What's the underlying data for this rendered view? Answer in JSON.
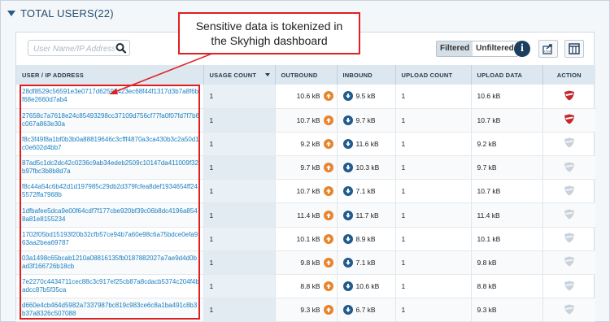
{
  "section": {
    "title": "TOTAL USERS(22)"
  },
  "search": {
    "placeholder": "User Name/IP Address"
  },
  "toggle": {
    "filtered": "Filtered",
    "unfiltered": "Unfiltered"
  },
  "toolbar": {
    "info_label": "i"
  },
  "table": {
    "headers": {
      "user": "USER / IP ADDRESS",
      "usage": "USAGE COUNT",
      "outbound": "OUTBOUND",
      "inbound": "INBOUND",
      "upload_count": "UPLOAD COUNT",
      "upload_data": "UPLOAD DATA",
      "action": "ACTION"
    },
    "rows": [
      {
        "user": "28df8529c56591e3e0717d62597423ec68f44f1317d3b7a8f6bf68e2660d7ab4",
        "usage": "1",
        "outbound": "10.6 kB",
        "inbound": "9.5 kB",
        "upload_count": "1",
        "upload_data": "10.6 kB",
        "shield": "red"
      },
      {
        "user": "27658c7a7618e24c85493298cc37109d756cf77fa0f07fd7f7b6c067a863e30a",
        "usage": "1",
        "outbound": "10.7 kB",
        "inbound": "9.7 kB",
        "upload_count": "1",
        "upload_data": "10.7 kB",
        "shield": "red"
      },
      {
        "user": "f8c3f49f8a1bf0b3b0a88819646c3cfff4870a3ca430b3c2a50d1c0e602d4bb7",
        "usage": "1",
        "outbound": "9.2 kB",
        "inbound": "11.6 kB",
        "upload_count": "1",
        "upload_data": "9.2 kB",
        "shield": "gray"
      },
      {
        "user": "87ad5c1dc2dc42c0236c9ab34edeb2509c10147da411009f32b97fbc3b8b8d7a",
        "usage": "1",
        "outbound": "9.7 kB",
        "inbound": "10.3 kB",
        "upload_count": "1",
        "upload_data": "9.7 kB",
        "shield": "gray"
      },
      {
        "user": "f8c44a54c6b42d1d197985c29db2d379fcfea8def1934654ff245572ffa7968b",
        "usage": "1",
        "outbound": "10.7 kB",
        "inbound": "7.1 kB",
        "upload_count": "1",
        "upload_data": "10.7 kB",
        "shield": "gray"
      },
      {
        "user": "1dfbafee5dca9e00f64cdf7f177cbe920bf39c06b8dc4196a8548a81e8155234",
        "usage": "1",
        "outbound": "11.4 kB",
        "inbound": "11.7 kB",
        "upload_count": "1",
        "upload_data": "11.4 kB",
        "shield": "gray"
      },
      {
        "user": "1702f05bd15193f20b32cfb57ce94b7a60e98c6a75bdce0efa963aa2bea69787",
        "usage": "1",
        "outbound": "10.1 kB",
        "inbound": "8.9 kB",
        "upload_count": "1",
        "upload_data": "10.1 kB",
        "shield": "gray"
      },
      {
        "user": "03a1498c65bcab1210a08816135fb0187882027a7ae9d4d0bad3f166726b18cb",
        "usage": "1",
        "outbound": "9.8 kB",
        "inbound": "7.1 kB",
        "upload_count": "1",
        "upload_data": "9.8 kB",
        "shield": "gray"
      },
      {
        "user": "7e2270c4434711cec88c3c917ef25cb87a8cdacb5374c204f4badcc87b5f35ca",
        "usage": "1",
        "outbound": "8.8 kB",
        "inbound": "10.6 kB",
        "upload_count": "1",
        "upload_data": "8.8 kB",
        "shield": "gray"
      },
      {
        "user": "d660e4cb464d5982a7337987bc819c983ce6c8a1ba491c8b3b37a8326c507088",
        "usage": "1",
        "outbound": "9.3 kB",
        "inbound": "6.7 kB",
        "upload_count": "1",
        "upload_data": "9.3 kB",
        "shield": "gray"
      }
    ]
  },
  "callout": {
    "line1": "Sensitive data is tokenized in",
    "line2": "the Skyhigh dashboard"
  },
  "colors": {
    "highlight": "#e02020",
    "link": "#1a7fc1",
    "shield_red": "#c8252c",
    "shield_gray": "#c9d2da",
    "upload_arrow": "#e8842c",
    "download_arrow": "#1f5b8c"
  },
  "icons": {
    "search": "search-icon",
    "info": "info-icon",
    "export": "csv-export-icon",
    "columns": "columns-icon",
    "sort": "sort-down-icon",
    "shield": "shield-icon"
  }
}
